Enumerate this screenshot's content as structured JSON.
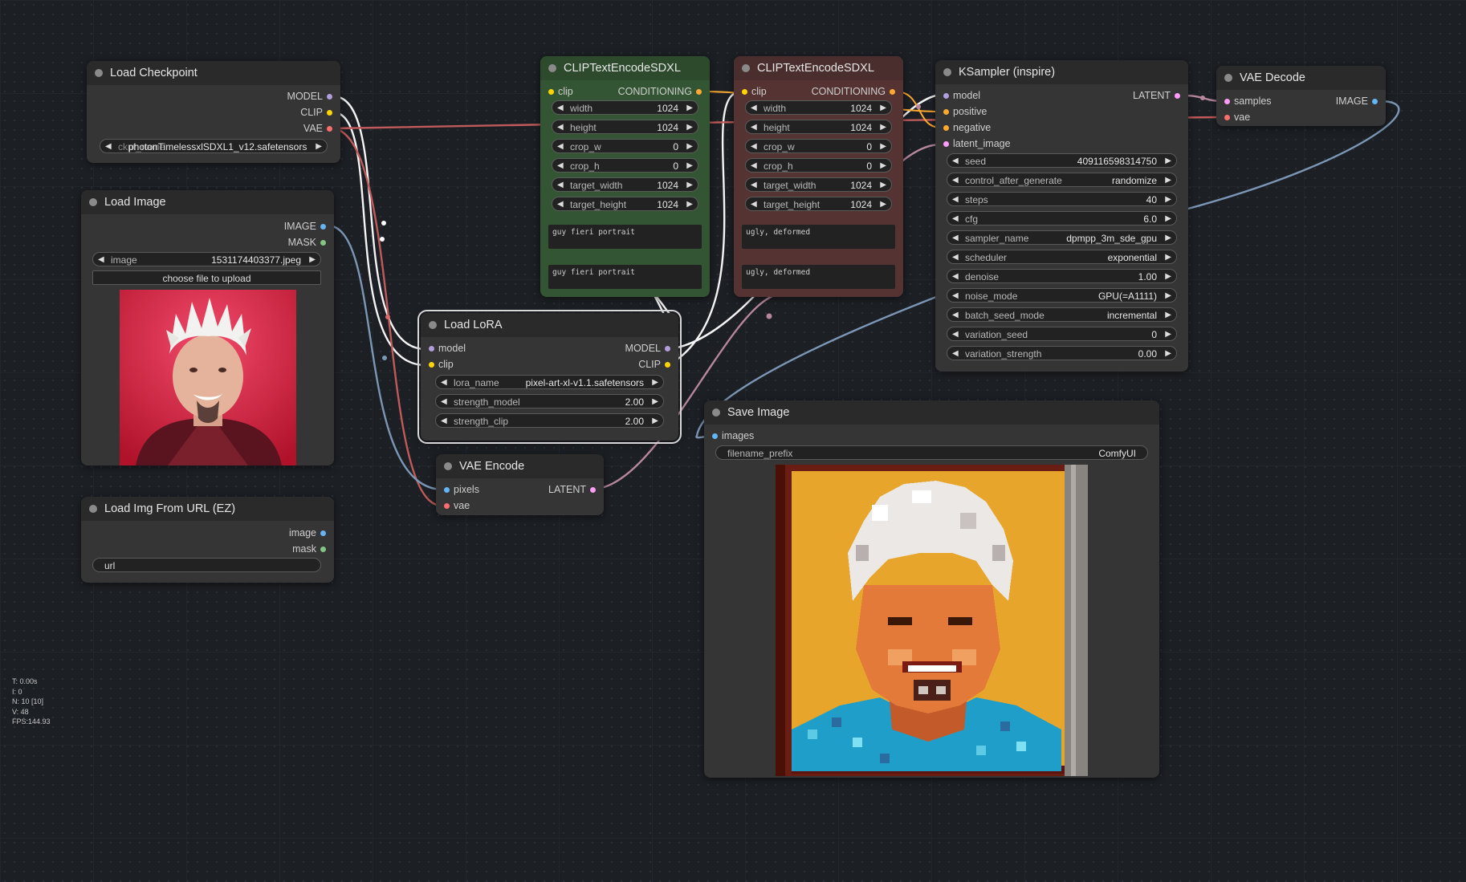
{
  "colors": {
    "model": "#b39ddb",
    "clip": "#ffd500",
    "vae": "#ff6e6e",
    "image": "#64b5f6",
    "mask": "#81c784",
    "latent": "#ff9cf9",
    "conditioning": "#ffa931",
    "wire_clip": "#f5f5f5",
    "wire_vae": "#c15a5a",
    "wire_image": "#7c97b6",
    "wire_latent": "#b7879d"
  },
  "nodes": {
    "load_checkpoint": {
      "title": "Load Checkpoint",
      "outputs": [
        "MODEL",
        "CLIP",
        "VAE"
      ],
      "ckpt_label": "ckpt_name",
      "ckpt_value": "photonTimelessxlSDXL1_v12.safetensors"
    },
    "load_image": {
      "title": "Load Image",
      "outputs": [
        "IMAGE",
        "MASK"
      ],
      "image_label": "image",
      "image_value": "1531174403377.jpeg",
      "upload_label": "choose file to upload",
      "preview_icon": "portrait-photo"
    },
    "load_img_url": {
      "title": "Load Img From URL (EZ)",
      "outputs": [
        "image",
        "mask"
      ],
      "url_label": "url"
    },
    "clip_pos": {
      "title": "CLIPTextEncodeSDXL",
      "input": "clip",
      "output": "CONDITIONING",
      "widgets": [
        {
          "label": "width",
          "value": "1024"
        },
        {
          "label": "height",
          "value": "1024"
        },
        {
          "label": "crop_w",
          "value": "0"
        },
        {
          "label": "crop_h",
          "value": "0"
        },
        {
          "label": "target_width",
          "value": "1024"
        },
        {
          "label": "target_height",
          "value": "1024"
        }
      ],
      "text_g": "guy fieri portrait",
      "text_l": "guy fieri portrait"
    },
    "clip_neg": {
      "title": "CLIPTextEncodeSDXL",
      "input": "clip",
      "output": "CONDITIONING",
      "widgets": [
        {
          "label": "width",
          "value": "1024"
        },
        {
          "label": "height",
          "value": "1024"
        },
        {
          "label": "crop_w",
          "value": "0"
        },
        {
          "label": "crop_h",
          "value": "0"
        },
        {
          "label": "target_width",
          "value": "1024"
        },
        {
          "label": "target_height",
          "value": "1024"
        }
      ],
      "text_g": "ugly, deformed",
      "text_l": "ugly, deformed"
    },
    "ksampler": {
      "title": "KSampler (inspire)",
      "inputs": [
        "model",
        "positive",
        "negative",
        "latent_image"
      ],
      "output": "LATENT",
      "widgets": [
        {
          "label": "seed",
          "value": "409116598314750"
        },
        {
          "label": "control_after_generate",
          "value": "randomize"
        },
        {
          "label": "steps",
          "value": "40"
        },
        {
          "label": "cfg",
          "value": "6.0"
        },
        {
          "label": "sampler_name",
          "value": "dpmpp_3m_sde_gpu"
        },
        {
          "label": "scheduler",
          "value": "exponential"
        },
        {
          "label": "denoise",
          "value": "1.00"
        },
        {
          "label": "noise_mode",
          "value": "GPU(=A1111)"
        },
        {
          "label": "batch_seed_mode",
          "value": "incremental"
        },
        {
          "label": "variation_seed",
          "value": "0"
        },
        {
          "label": "variation_strength",
          "value": "0.00"
        }
      ]
    },
    "vae_decode": {
      "title": "VAE Decode",
      "inputs": [
        "samples",
        "vae"
      ],
      "output": "IMAGE"
    },
    "load_lora": {
      "title": "Load LoRA",
      "inputs": [
        "model",
        "clip"
      ],
      "outputs": [
        "MODEL",
        "CLIP"
      ],
      "widgets": [
        {
          "label": "lora_name",
          "value": "pixel-art-xl-v1.1.safetensors"
        },
        {
          "label": "strength_model",
          "value": "2.00"
        },
        {
          "label": "strength_clip",
          "value": "2.00"
        }
      ]
    },
    "vae_encode": {
      "title": "VAE Encode",
      "inputs": [
        "pixels",
        "vae"
      ],
      "output": "LATENT"
    },
    "save_image": {
      "title": "Save Image",
      "input": "images",
      "prefix_label": "filename_prefix",
      "prefix_value": "ComfyUI",
      "preview_icon": "pixel-art-portrait"
    }
  },
  "stats": [
    "T: 0.00s",
    "I: 0",
    "N: 10 [10]",
    "V: 48",
    "FPS:144.93"
  ]
}
